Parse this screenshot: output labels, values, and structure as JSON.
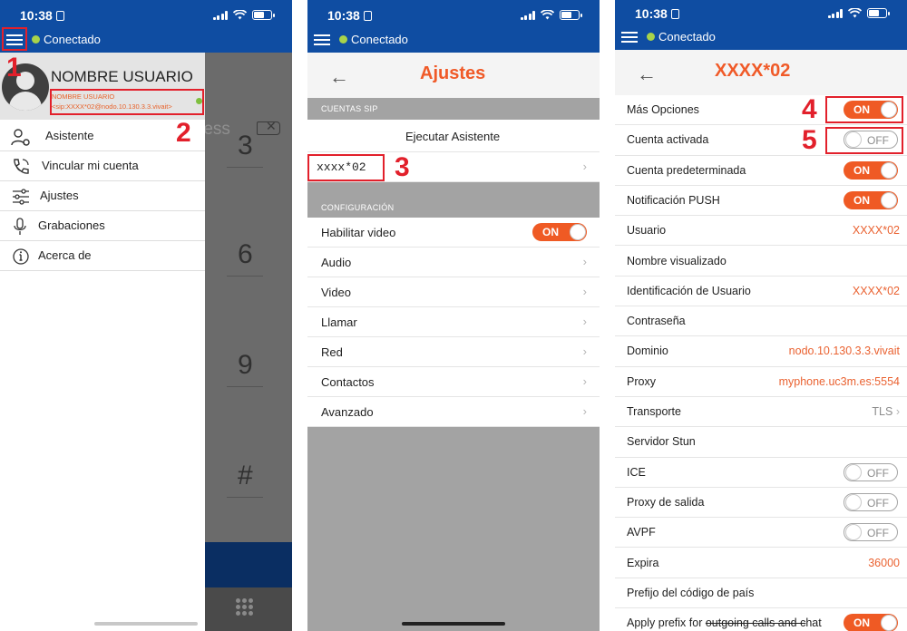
{
  "status": {
    "time": "10:38"
  },
  "appbar": {
    "connection": "Conectado"
  },
  "annotations": [
    "1",
    "2",
    "3",
    "4",
    "5"
  ],
  "panel1": {
    "user_name": "NOMBRE USUARIO",
    "sip_label": "NOMBRE USUARIO",
    "sip_address": "<sip:XXXX*02@nodo.10.130.3.3.vivait>",
    "address_placeholder": "ress",
    "dial_digits": [
      "3",
      "6",
      "9",
      "#"
    ],
    "menu": [
      {
        "label": "Asistente",
        "icon": "user-gear-icon"
      },
      {
        "label": "Vincular mi cuenta",
        "icon": "phone-link-icon"
      },
      {
        "label": "Ajustes",
        "icon": "sliders-icon"
      },
      {
        "label": "Grabaciones",
        "icon": "microphone-icon"
      },
      {
        "label": "Acerca de",
        "icon": "info-icon"
      }
    ]
  },
  "panel2": {
    "title": "Ajustes",
    "section_sip": "CUENTAS SIP",
    "run_assistant": "Ejecutar Asistente",
    "account": "xxxx*02",
    "section_config": "CONFIGURACIÓN",
    "video_toggle_label": "Habilitar video",
    "video_toggle_state": "ON",
    "rows": [
      "Audio",
      "Video",
      "Llamar",
      "Red",
      "Contactos",
      "Avanzado"
    ]
  },
  "panel3": {
    "title": "XXXX*02",
    "rows": [
      {
        "label": "Más Opciones",
        "toggle": "ON"
      },
      {
        "label": "Cuenta activada",
        "toggle": "OFF"
      },
      {
        "label": "Cuenta predeterminada",
        "toggle": "ON"
      },
      {
        "label": "Notificación PUSH",
        "toggle": "ON"
      },
      {
        "label": "Usuario",
        "value": "XXXX*02"
      },
      {
        "label": "Nombre visualizado"
      },
      {
        "label": "Identificación de Usuario",
        "value": "XXXX*02"
      },
      {
        "label": "Contraseña"
      },
      {
        "label": "Dominio",
        "value": "nodo.10.130.3.3.vivait"
      },
      {
        "label": "Proxy",
        "value": "myphone.uc3m.es:5554"
      },
      {
        "label": "Transporte",
        "value": "TLS",
        "chevron": true
      },
      {
        "label": "Servidor Stun"
      },
      {
        "label": "ICE",
        "toggle": "OFF"
      },
      {
        "label": "Proxy de salida",
        "toggle": "OFF"
      },
      {
        "label": "AVPF",
        "toggle": "OFF"
      },
      {
        "label": "Expira",
        "value": "36000"
      },
      {
        "label": "Prefijo del código de país"
      }
    ],
    "last_row_prefix": "Apply prefix for ",
    "last_row_strike": "outgoing calls and c",
    "last_row_suffix": "hat",
    "last_row_toggle": "ON"
  },
  "colors": {
    "brand_blue": "#0f4da2",
    "accent_orange": "#ef5a24",
    "annotation_red": "#e2202b",
    "online_green": "#a8d34a"
  }
}
